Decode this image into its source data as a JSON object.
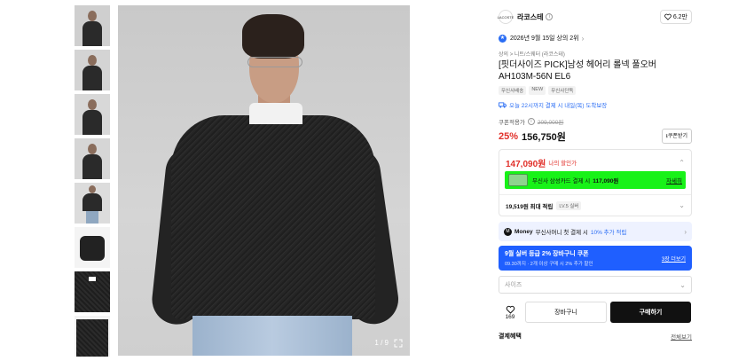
{
  "gallery": {
    "counter": "1 / 9",
    "thumbnails": [
      "thumb-1",
      "thumb-2",
      "thumb-3",
      "thumb-4",
      "thumb-5",
      "thumb-6",
      "thumb-7",
      "thumb-8"
    ]
  },
  "brand": {
    "logo_text": "LACOSTE",
    "name": "라코스테",
    "likes": "6.2만"
  },
  "rank": {
    "text": "2026년 9월 15일 상의 2위",
    "chevron": "›"
  },
  "breadcrumb": "상의 > 니트/스웨터 (라코스테)",
  "product": {
    "title": "[핏더사이즈 PICK]남성 헤어리 롤넥 풀오버 AH103M-56N EL6",
    "tags": [
      "무신사배송",
      "NEW",
      "무신사단독"
    ],
    "delivery": "오늘 22시까지 결제 시 내일(목) 도착보장"
  },
  "pricing": {
    "coupon_label": "쿠폰적용가",
    "original": "209,000원",
    "discount": "25%",
    "price": "156,750원",
    "coupon_button": "쿠폰받기",
    "my_price": "147,090원",
    "my_price_label": "나의 할인가",
    "card_offer": "무신사 삼성카드 결제 시",
    "card_price": "117,090원",
    "card_detail": "자세히",
    "reward": "19,519원 최대 적립",
    "reward_badge": "LV.5 실버"
  },
  "money": {
    "logo": "M",
    "brand": "Money",
    "text": "무신사머니 첫 결제 시",
    "accent": "10% 추가 적립"
  },
  "promo": {
    "title": "9월 실버 등급 2% 장바구니 쿠폰",
    "subtitle": "09.30까지 · 2개 이상 구매 시 2% 추가 할인",
    "link": "3장 더보기"
  },
  "size": {
    "placeholder": "사이즈"
  },
  "actions": {
    "like_count": "169",
    "cart": "장바구니",
    "buy": "구매하기"
  },
  "benefits": {
    "title": "결제혜택",
    "see_all": "전체보기"
  },
  "colors": {
    "accent_red": "#e1302a",
    "accent_blue": "#2a6df4",
    "promo_green": "#18f218",
    "promo_blue": "#1f5fff"
  }
}
